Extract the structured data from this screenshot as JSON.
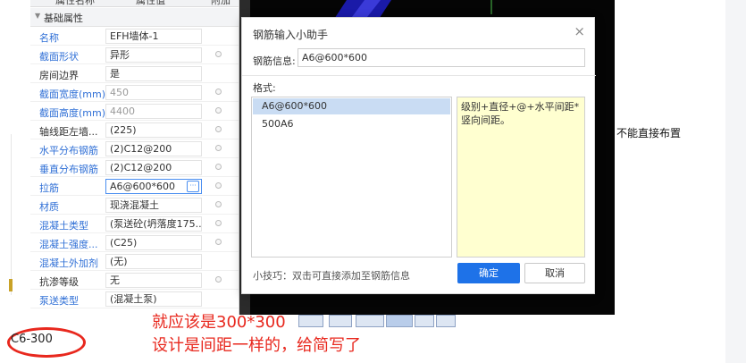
{
  "property_panel": {
    "header": {
      "col_name": "属性名称",
      "col_value": "属性值",
      "col_extra": "附加"
    },
    "group_title": "基础属性",
    "rows": [
      {
        "label": "名称",
        "value": "EFH墙体-1",
        "label_color": "blue",
        "value_color": "normal",
        "has_dot": false
      },
      {
        "label": "截面形状",
        "value": "异形",
        "label_color": "blue",
        "value_color": "normal",
        "has_dot": true
      },
      {
        "label": "房间边界",
        "value": "是",
        "label_color": "dark",
        "value_color": "normal",
        "has_dot": false
      },
      {
        "label": "截面宽度(mm)",
        "value": "450",
        "label_color": "blue",
        "value_color": "gray",
        "has_dot": true
      },
      {
        "label": "截面高度(mm)",
        "value": "4400",
        "label_color": "blue",
        "value_color": "gray",
        "has_dot": true
      },
      {
        "label": "轴线距左墙...",
        "value": "(225)",
        "label_color": "dark",
        "value_color": "normal",
        "has_dot": true
      },
      {
        "label": "水平分布钢筋",
        "value": "(2)C12@200",
        "label_color": "blue",
        "value_color": "normal",
        "has_dot": true
      },
      {
        "label": "垂直分布钢筋",
        "value": "(2)C12@200",
        "label_color": "blue",
        "value_color": "normal",
        "has_dot": true
      },
      {
        "label": "拉筋",
        "value": "A6@600*600",
        "label_color": "blue",
        "value_color": "normal",
        "has_dot": true,
        "active": true
      },
      {
        "label": "材质",
        "value": "现浇混凝土",
        "label_color": "blue",
        "value_color": "normal",
        "has_dot": true
      },
      {
        "label": "混凝土类型",
        "value": "(泵送砼(坍落度175...",
        "label_color": "blue",
        "value_color": "normal",
        "has_dot": true
      },
      {
        "label": "混凝土强度...",
        "value": "(C25)",
        "label_color": "blue",
        "value_color": "normal",
        "has_dot": true
      },
      {
        "label": "混凝土外加剂",
        "value": "(无)",
        "label_color": "blue",
        "value_color": "normal",
        "has_dot": false
      },
      {
        "label": "抗渗等级",
        "value": "无",
        "label_color": "dark",
        "value_color": "normal",
        "has_dot": true
      },
      {
        "label": "泵送类型",
        "value": "(混凝土泵)",
        "label_color": "blue",
        "value_color": "normal",
        "has_dot": false
      }
    ]
  },
  "dialog": {
    "title": "钢筋输入小助手",
    "close_glyph": "×",
    "info_label": "钢筋信息:",
    "info_value": "A6@600*600",
    "format_label": "格式:",
    "formats": [
      {
        "text": "A6@600*600",
        "selected": true
      },
      {
        "text": "500A6",
        "selected": false
      }
    ],
    "format_description": "级别+直径+@+水平间距*竖向间距。",
    "tip": "小技巧：双击可直接添加至钢筋信息",
    "ok_label": "确定",
    "cancel_label": "取消"
  },
  "side_note": "不能直接布置",
  "annotation": {
    "line1": "就应该是300*300",
    "line2": "设计是间距一样的，给简写了"
  },
  "bottom_code": "C6-300",
  "colors": {
    "annotation_red": "#e8281e",
    "label_blue": "#2f6fd6",
    "ok_blue": "#1e72e8",
    "selection_blue": "#c9dcf3",
    "description_yellow": "#ffffd0"
  },
  "icons": {
    "group_toggle": "caret-down-icon",
    "row_attach": "circle-dot-icon",
    "ellipsis": "ellipsis-icon"
  }
}
